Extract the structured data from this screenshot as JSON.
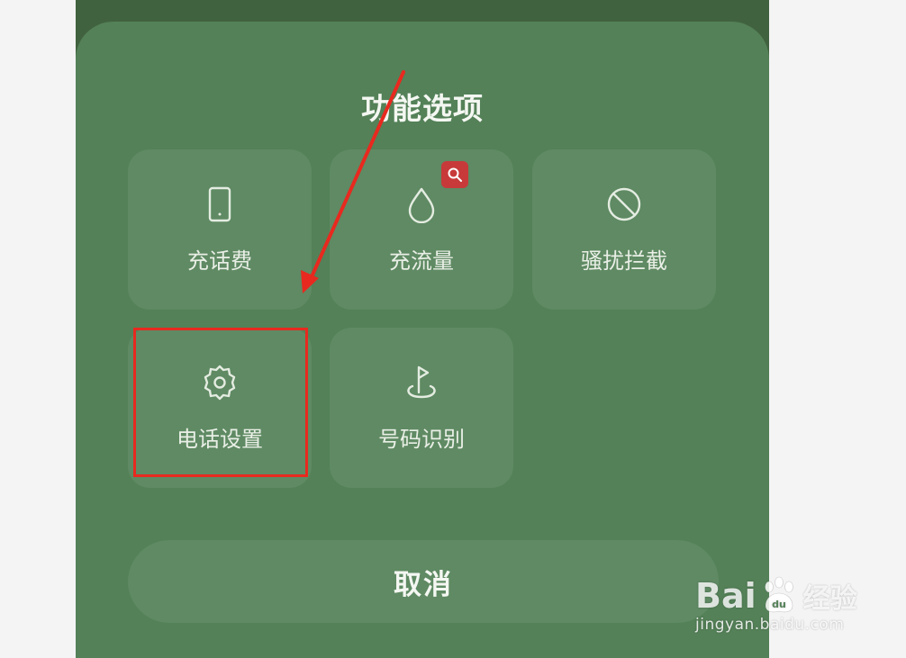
{
  "sheet": {
    "title": "功能选项",
    "options": [
      {
        "label": "充话费",
        "icon": "phone-tablet-icon"
      },
      {
        "label": "充流量",
        "icon": "water-drop-icon",
        "badge_icon": "search-icon"
      },
      {
        "label": "骚扰拦截",
        "icon": "block-icon"
      },
      {
        "label": "电话设置",
        "icon": "gear-icon"
      },
      {
        "label": "号码识别",
        "icon": "flag-pin-icon"
      }
    ],
    "cancel_label": "取消"
  },
  "annotation": {
    "highlight_color": "#e8291f",
    "arrow_color": "#e8291f"
  },
  "watermark": {
    "brand": "Bai",
    "brand_tail": "du",
    "cn": "经验",
    "url": "jingyan.baidu.com"
  }
}
